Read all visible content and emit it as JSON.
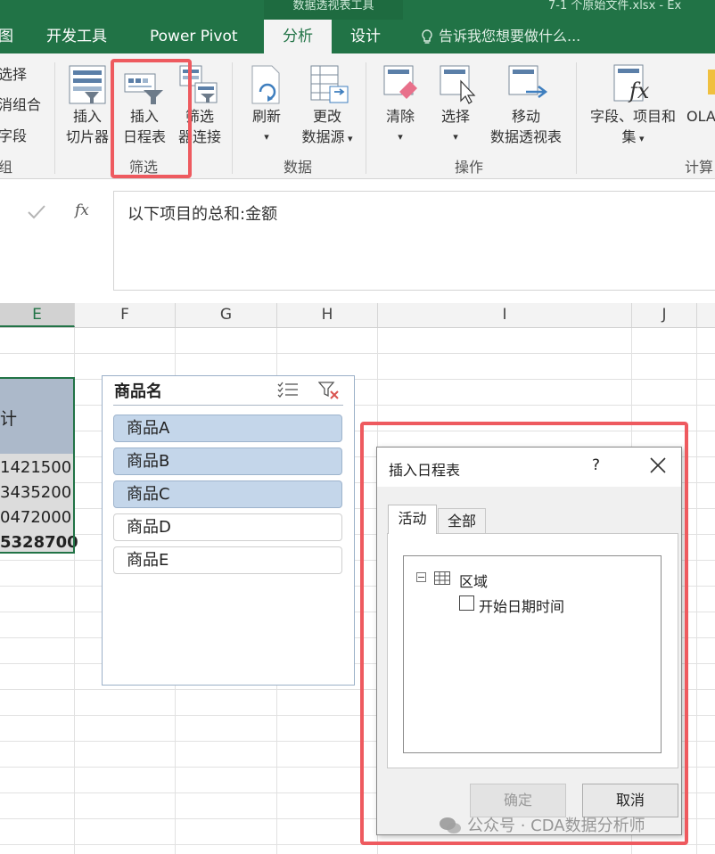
{
  "window": {
    "context_title": "数据透视表工具",
    "file_title": "7-1 个原始文件.xlsx - Ex"
  },
  "tabs": {
    "cut_left": "图",
    "developer": "开发工具",
    "power_pivot": "Power Pivot",
    "analyze": "分析",
    "design": "设计",
    "tell_me": "告诉我您想要做什么..."
  },
  "ribbon": {
    "partial_left": [
      "选择",
      "消组合",
      "字段"
    ],
    "partial_group": "组",
    "filter_group": {
      "name": "筛选",
      "insert_slicer": [
        "插入",
        "切片器"
      ],
      "insert_timeline": [
        "插入",
        "日程表"
      ],
      "filter_connections": [
        "筛选",
        "器连接"
      ]
    },
    "data_group": {
      "name": "数据",
      "refresh": "刷新",
      "change_source": [
        "更改",
        "数据源"
      ]
    },
    "actions_group": {
      "name": "操作",
      "clear": "清除",
      "select": "选择",
      "move_pivot": [
        "移动",
        "数据透视表"
      ]
    },
    "calc_group": {
      "name": "计算",
      "fields_items": [
        "字段、项目和",
        "集"
      ],
      "olap_partial": "OLA"
    }
  },
  "formula_bar": {
    "fx_label": "fx",
    "formula": "以下项目的总和:金额"
  },
  "columns": [
    "E",
    "F",
    "G",
    "H",
    "I",
    "J"
  ],
  "pivot": {
    "header_partial": "计",
    "values": [
      "1421500",
      "3435200",
      "0472000"
    ],
    "total": "5328700"
  },
  "slicer": {
    "title": "商品名",
    "items": [
      {
        "label": "商品A",
        "selected": true
      },
      {
        "label": "商品B",
        "selected": true
      },
      {
        "label": "商品C",
        "selected": true
      },
      {
        "label": "商品D",
        "selected": false
      },
      {
        "label": "商品E",
        "selected": false
      }
    ]
  },
  "dialog": {
    "title": "插入日程表",
    "help": "?",
    "tab_active": "活动",
    "tab_all": "全部",
    "tree_root": "区域",
    "tree_child": "开始日期时间",
    "ok": "确定",
    "cancel": "取消"
  },
  "watermark": "公众号 · CDA数据分析师",
  "colors": {
    "excel_green": "#217346",
    "highlight_red": "#ee5a5f",
    "slicer_selected": "#c4d6ea",
    "pivot_header": "#acb9ca"
  }
}
